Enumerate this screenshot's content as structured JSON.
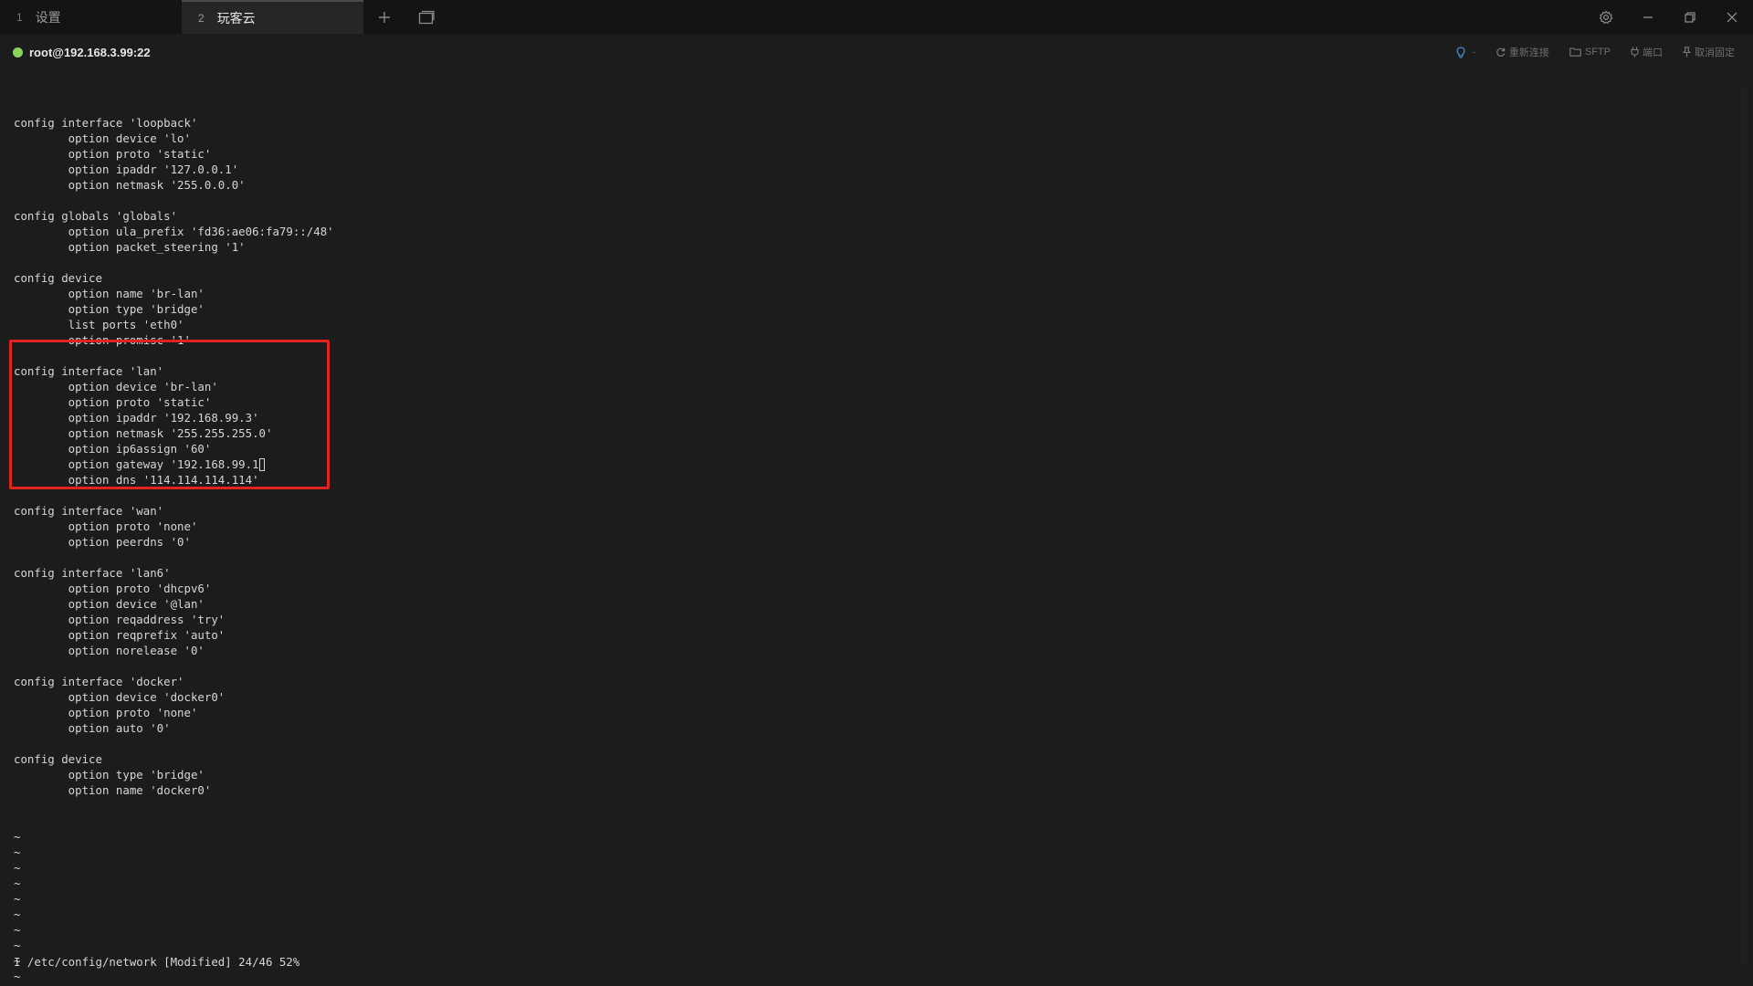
{
  "tabs": [
    {
      "number": "1",
      "label": "设置",
      "active": false
    },
    {
      "number": "2",
      "label": "玩客云",
      "active": true
    }
  ],
  "tab_actions": {
    "new_tab_icon": "plus-icon",
    "duplicate_icon": "window-icon"
  },
  "window_controls": {
    "settings_icon": "gear-icon",
    "minimize_icon": "minimize-icon",
    "restore_icon": "restore-icon",
    "close_icon": "close-icon"
  },
  "session": {
    "host": "root@192.168.3.99:22",
    "status_color": "#8bd35a",
    "status_icon": "status-dot-icon"
  },
  "toolbar": {
    "light_caret": "-",
    "reconnect_label": "重新连接",
    "sftp_label": "SFTP",
    "port_label": "端口",
    "unpin_label": "取消固定"
  },
  "terminal": {
    "lines": [
      "",
      "config interface 'loopback'",
      "        option device 'lo'",
      "        option proto 'static'",
      "        option ipaddr '127.0.0.1'",
      "        option netmask '255.0.0.0'",
      "",
      "config globals 'globals'",
      "        option ula_prefix 'fd36:ae06:fa79::/48'",
      "        option packet_steering '1'",
      "",
      "config device",
      "        option name 'br-lan'",
      "        option type 'bridge'",
      "        list ports 'eth0'",
      "        option promisc '1'",
      "",
      "config interface 'lan'",
      "        option device 'br-lan'",
      "        option proto 'static'",
      "        option ipaddr '192.168.99.3'",
      "        option netmask '255.255.255.0'",
      "        option ip6assign '60'",
      "        option gateway '192.168.99.1",
      "        option dns '114.114.114.114'",
      "",
      "config interface 'wan'",
      "        option proto 'none'",
      "        option peerdns '0'",
      "",
      "config interface 'lan6'",
      "        option proto 'dhcpv6'",
      "        option device '@lan'",
      "        option reqaddress 'try'",
      "        option reqprefix 'auto'",
      "        option norelease '0'",
      "",
      "config interface 'docker'",
      "        option device 'docker0'",
      "        option proto 'none'",
      "        option auto '0'",
      "",
      "config device",
      "        option type 'bridge'",
      "        option name 'docker0'",
      "",
      "",
      "~",
      "~",
      "~",
      "~",
      "~",
      "~",
      "~",
      "~",
      "~",
      "~"
    ],
    "cursor_line_index": 23,
    "status_line": "I /etc/config/network [Modified] 24/46 52%"
  },
  "colors": {
    "background": "#1c1c1c",
    "tabbar": "#141414",
    "highlight": "#e0231c",
    "text": "#d6d6d6"
  }
}
